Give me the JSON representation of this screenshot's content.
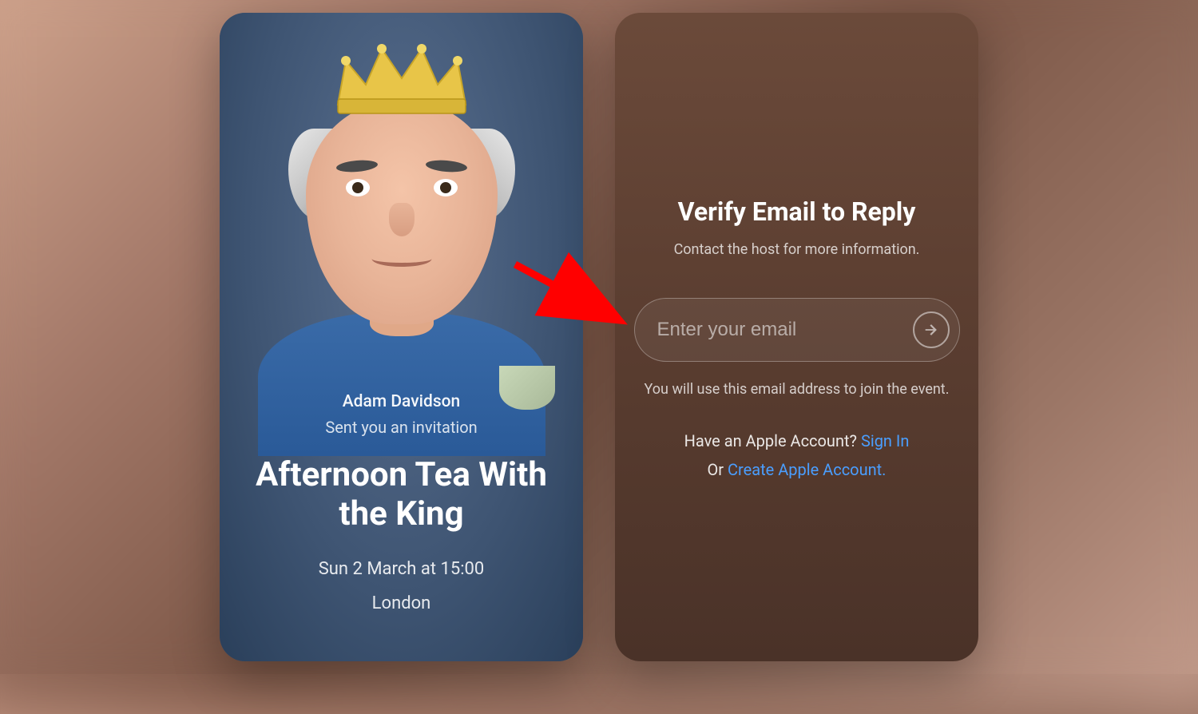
{
  "invite": {
    "host_name": "Adam Davidson",
    "invitation_text": "Sent you an invitation",
    "event_title": "Afternoon Tea With the King",
    "datetime": "Sun 2 March at 15:00",
    "location": "London"
  },
  "verify": {
    "title": "Verify Email to Reply",
    "subtitle": "Contact the host for more information.",
    "email_placeholder": "Enter your email",
    "email_note": "You will use this email address to join the event.",
    "have_account_text": "Have an Apple Account? ",
    "sign_in_label": "Sign In",
    "or_text": "Or ",
    "create_account_label": "Create Apple Account."
  },
  "icons": {
    "submit": "arrow-right-icon"
  },
  "colors": {
    "link": "#4a9eff",
    "annotation_arrow": "#ff0000"
  }
}
